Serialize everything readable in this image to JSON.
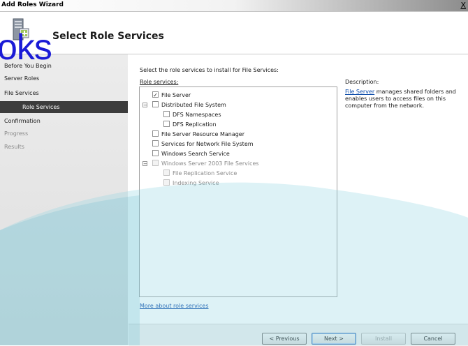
{
  "window": {
    "title": "Add Roles Wizard",
    "close_glyph": "X"
  },
  "header": {
    "title": "Select Role Services",
    "icon": "server-roles-icon"
  },
  "watermark": {
    "text": "oks"
  },
  "sidebar": {
    "items": [
      {
        "label": "Before You Begin",
        "state": "normal"
      },
      {
        "label": "Server Roles",
        "state": "normal"
      },
      {
        "label": "File Services",
        "state": "normal"
      },
      {
        "label": "Role Services",
        "state": "selected"
      },
      {
        "label": "Confirmation",
        "state": "normal"
      },
      {
        "label": "Progress",
        "state": "gray"
      },
      {
        "label": "Results",
        "state": "gray"
      }
    ]
  },
  "main": {
    "prompt": "Select the role services to install for File Services:",
    "role_services_label": "Role services:",
    "tree": [
      {
        "label": "File Server",
        "checked": true
      },
      {
        "label": "Distributed File System",
        "checked": false,
        "expander": "⊟"
      },
      {
        "label": "DFS Namespaces",
        "checked": false
      },
      {
        "label": "DFS Replication",
        "checked": false
      },
      {
        "label": "File Server Resource Manager",
        "checked": false
      },
      {
        "label": "Services for Network File System",
        "checked": false
      },
      {
        "label": "Windows Search Service",
        "checked": false
      },
      {
        "label": "Windows Server 2003 File Services",
        "checked": false,
        "expander": "⊟"
      },
      {
        "label": "File Replication Service",
        "checked": false
      },
      {
        "label": "Indexing Service",
        "checked": false
      }
    ],
    "description": {
      "heading": "Description:",
      "link": "File Server",
      "text": " manages shared folders and enables users to access files on this computer from the network."
    },
    "more_link": "More about role services"
  },
  "footer": {
    "previous": "< Previous",
    "next": "Next >",
    "install": "Install",
    "cancel": "Cancel"
  }
}
